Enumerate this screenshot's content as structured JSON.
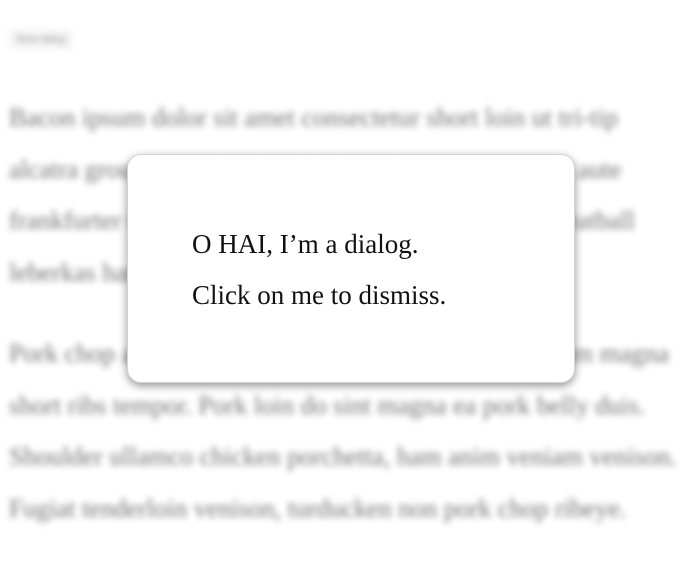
{
  "toolbar": {
    "show_dialog_label": "Show dialog"
  },
  "article": {
    "paragraphs": [
      "Bacon ipsum dolor sit amet consectetur short loin ut tri-tip alcatra ground round fatback biltong beef in pork. Elit aute frankfurter tenderloin, andouille ea boudin pariatur meatball leberkas ham hock tongue.",
      "Pork chop ad turducken kielbasa pastrami alcatra cillum magna short ribs tempor. Pork loin do sint magna ea pork belly duis. Shoulder ullamco chicken porchetta, ham anim veniam venison. Fugiat tenderloin venison, turducken non pork chop ribeye."
    ]
  },
  "dialog": {
    "line1": "O HAI, I’m a dialog.",
    "line2": "Click on me to dismiss."
  }
}
